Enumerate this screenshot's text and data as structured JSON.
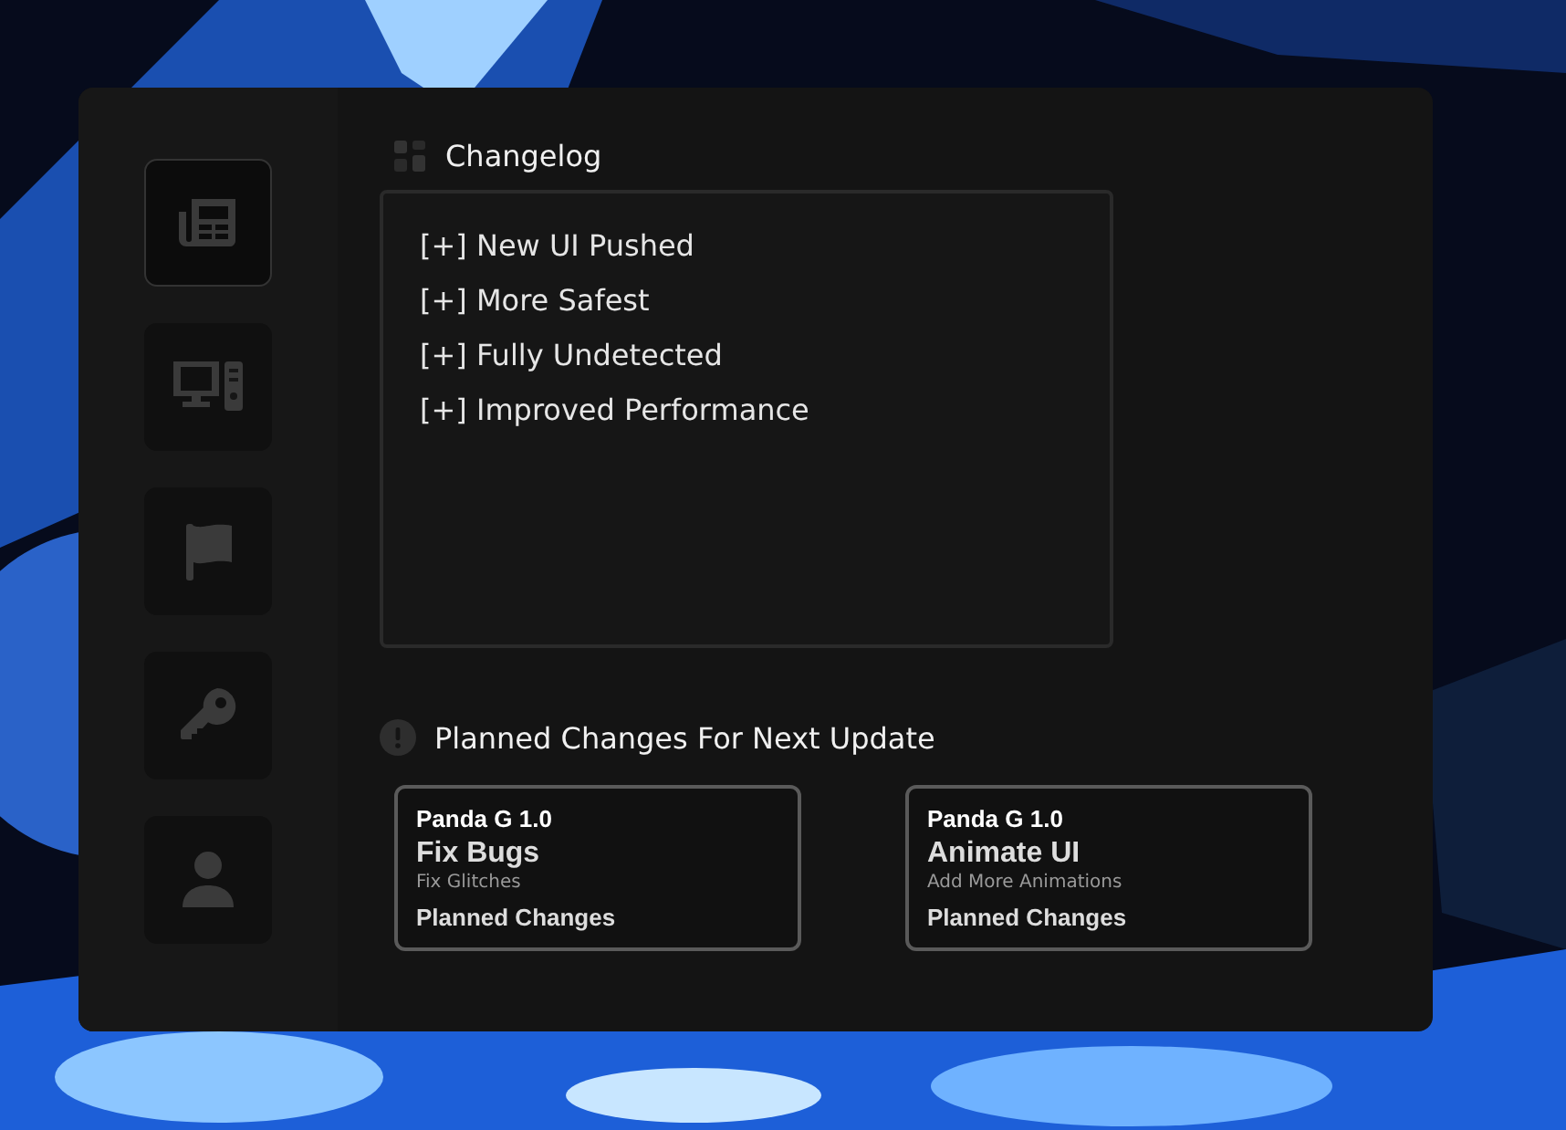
{
  "sidebar": {
    "items": [
      {
        "selected": true
      },
      {
        "selected": false
      },
      {
        "selected": false
      },
      {
        "selected": false
      },
      {
        "selected": false
      }
    ]
  },
  "changelog": {
    "title": "Changelog",
    "entries": [
      "[+] New UI Pushed",
      "[+] More Safest",
      "[+] Fully Undetected",
      "[+] Improved Performance"
    ]
  },
  "planned": {
    "title": "Planned Changes For Next Update",
    "cards": [
      {
        "product": "Panda G 1.0",
        "title": "Fix Bugs",
        "subtitle": "Fix Glitches",
        "footer": "Planned Changes"
      },
      {
        "product": "Panda G 1.0",
        "title": "Animate UI",
        "subtitle": "Add More Animations",
        "footer": "Planned Changes"
      }
    ]
  }
}
